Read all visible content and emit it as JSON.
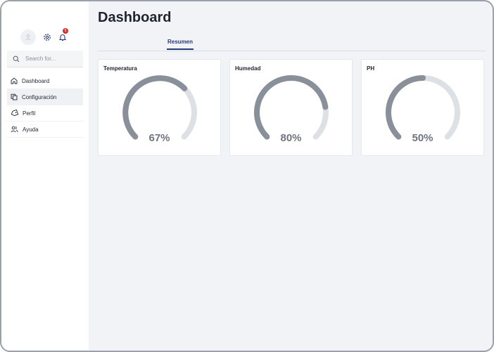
{
  "sidebar": {
    "search": {
      "placeholder": "Search for..."
    },
    "notifications": {
      "count": "5"
    },
    "items": [
      {
        "label": "Dashboard",
        "icon": "home-icon"
      },
      {
        "label": "Configuración",
        "icon": "copy-icon",
        "active": true
      },
      {
        "label": "Perfil",
        "icon": "tag-icon"
      },
      {
        "label": "Ayuda",
        "icon": "users-icon"
      }
    ]
  },
  "main": {
    "title": "Dashboard",
    "tabs": [
      {
        "label": "Resumen",
        "active": true
      }
    ],
    "cards": [
      {
        "title": "Temperatura",
        "value_text": "67%",
        "value": 67
      },
      {
        "title": "Humedad",
        "value_text": "80%",
        "value": 80
      },
      {
        "title": "PH",
        "value_text": "50%",
        "value": 50
      }
    ]
  },
  "colors": {
    "gauge_fill": "#8a9099",
    "gauge_track": "#dde0e5",
    "accent": "#2a3a78",
    "badge": "#d62e2e"
  }
}
